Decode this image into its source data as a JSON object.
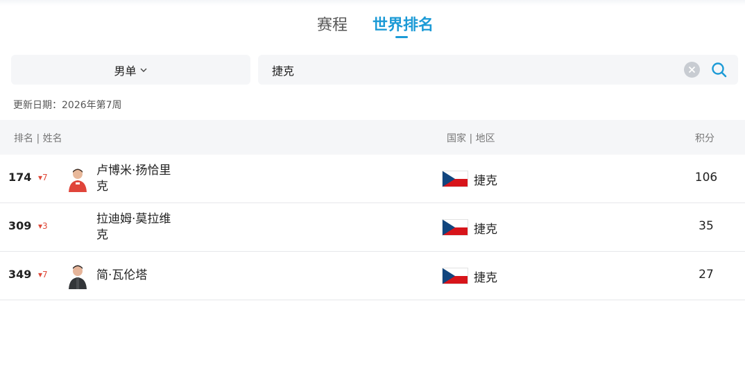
{
  "tabs": [
    {
      "label": "赛程",
      "active": false
    },
    {
      "label": "世界排名",
      "active": true
    }
  ],
  "filter": {
    "category": "男单",
    "search_value": "捷克"
  },
  "update_text": "更新日期：2026年第7周",
  "table": {
    "headers": {
      "rank_name": "排名 | 姓名",
      "country": "国家 | 地区",
      "points": "积分"
    },
    "rows": [
      {
        "rank": "174",
        "change": "7",
        "name_line1": "卢博米·扬恰里",
        "name_line2": "克",
        "country": "捷克",
        "points": "106",
        "has_avatar": true
      },
      {
        "rank": "309",
        "change": "3",
        "name_line1": "拉迪姆·莫拉维",
        "name_line2": "克",
        "country": "捷克",
        "points": "35",
        "has_avatar": false
      },
      {
        "rank": "349",
        "change": "7",
        "name_line1": "简·瓦伦塔",
        "name_line2": "",
        "country": "捷克",
        "points": "27",
        "has_avatar": true
      }
    ]
  },
  "colors": {
    "accent": "#1b9ad6",
    "down": "#e04a3a",
    "panel": "#f5f6f8"
  },
  "icons": {
    "dropdown": "chevron-down-icon",
    "clear": "clear-icon",
    "search": "search-icon",
    "trend": "arrow-down-icon",
    "flag": "czech-flag-icon"
  }
}
